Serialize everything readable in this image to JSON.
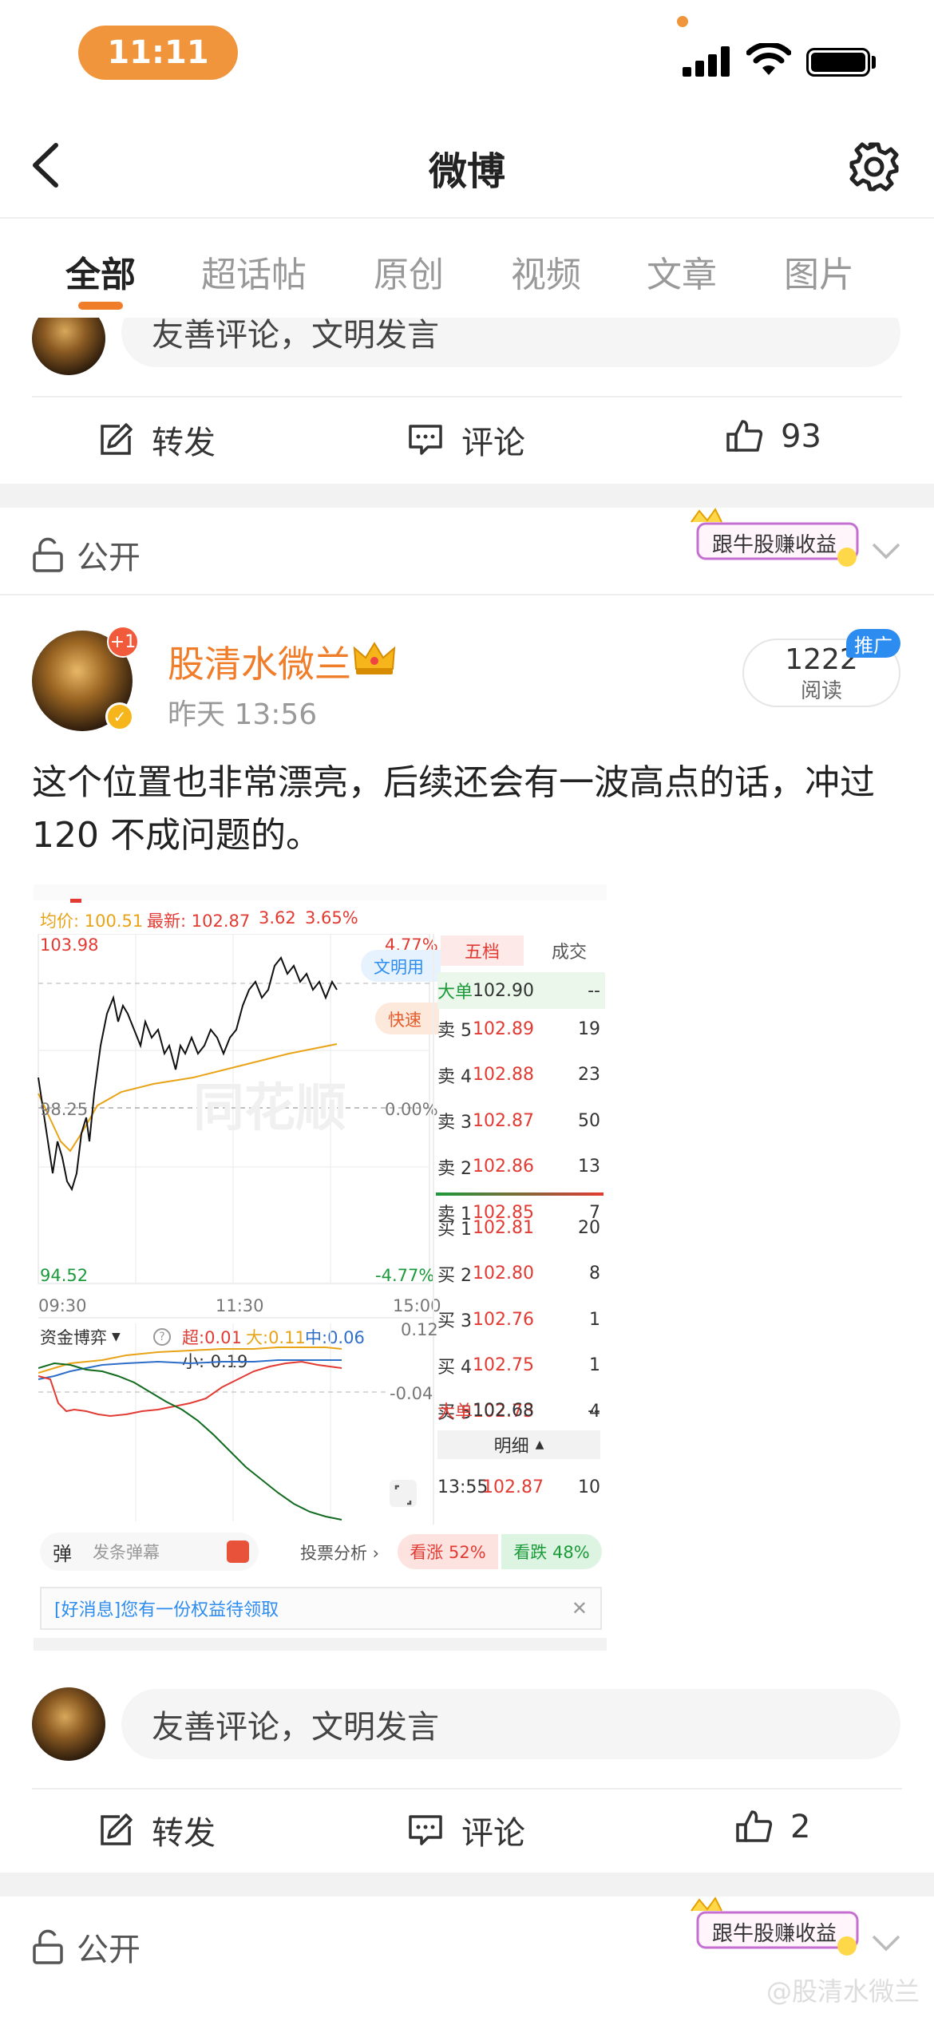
{
  "status_bar": {
    "time": "11:11"
  },
  "header": {
    "title": "微博"
  },
  "tabs": [
    "全部",
    "超话帖",
    "原创",
    "视频",
    "文章",
    "图片"
  ],
  "comment_placeholder": "友善评论，文明发言",
  "actions": {
    "repost": "转发",
    "comment": "评论",
    "like_count_top": "93",
    "like_count_bottom": "2"
  },
  "privacy": {
    "label": "公开"
  },
  "follow_badge": {
    "text": "跟牛股赚收益"
  },
  "post": {
    "author": "股清水微兰",
    "time": "昨天 13:56",
    "plus_badge": "+1",
    "read_count": "1222",
    "read_label": "阅读",
    "promo_tag": "推广",
    "text": "这个位置也非常漂亮，后续还会有一波高点的话，冲过 120 不成问题的。"
  },
  "stock_card": {
    "header_avg_label": "均价: 100.51",
    "header_latest": "最新: 102.87",
    "header_change": "3.62",
    "header_pct": "3.65%",
    "y_top": "103.98",
    "y_mid": "98.25",
    "y_bottom": "94.52",
    "pct_top": "4.77%",
    "pct_mid": "0.00%",
    "pct_bottom": "-4.77%",
    "x_start": "09:30",
    "x_mid": "11:30",
    "x_end": "15:00",
    "chip_civil": "文明用",
    "chip_fast": "快速",
    "tab_five": "五档",
    "tab_trades": "成交",
    "big_sell_label": "大单",
    "big_sell_price": "102.90",
    "big_sell_vol": "--",
    "asks": [
      {
        "label": "卖 5",
        "price": "102.89",
        "vol": "19"
      },
      {
        "label": "卖 4",
        "price": "102.88",
        "vol": "23"
      },
      {
        "label": "卖 3",
        "price": "102.87",
        "vol": "50"
      },
      {
        "label": "卖 2",
        "price": "102.86",
        "vol": "13"
      },
      {
        "label": "卖 1",
        "price": "102.85",
        "vol": "7"
      }
    ],
    "bids": [
      {
        "label": "买 1",
        "price": "102.81",
        "vol": "20"
      },
      {
        "label": "买 2",
        "price": "102.80",
        "vol": "8"
      },
      {
        "label": "买 3",
        "price": "102.76",
        "vol": "1"
      },
      {
        "label": "买 4",
        "price": "102.75",
        "vol": "1"
      },
      {
        "label": "买 5",
        "price": "102.73",
        "vol": "4"
      }
    ],
    "big_buy_label": "大单",
    "big_buy_price": "102.68",
    "big_buy_vol": "--",
    "detail_label": "明细",
    "trade_time": "13:55",
    "trade_price": "102.87",
    "trade_vol": "10",
    "fund_label": "资金博弈",
    "fund_super": "超:0.01",
    "fund_large": "大:0.11",
    "fund_mid": "中:0.06",
    "fund_small": "小:-0.19",
    "fund_y_top": "0.12",
    "fund_y_mid": "-0.04",
    "danmu_placeholder": "发条弹幕",
    "analysis": "投票分析",
    "bull": "看涨 52%",
    "bear": "看跌 48%",
    "notice": "[好消息]您有一份权益待领取"
  },
  "watermark": "@股清水微兰",
  "colors": {
    "accent": "#f07d2a",
    "red": "#e23b33",
    "green": "#1b9a3a"
  }
}
